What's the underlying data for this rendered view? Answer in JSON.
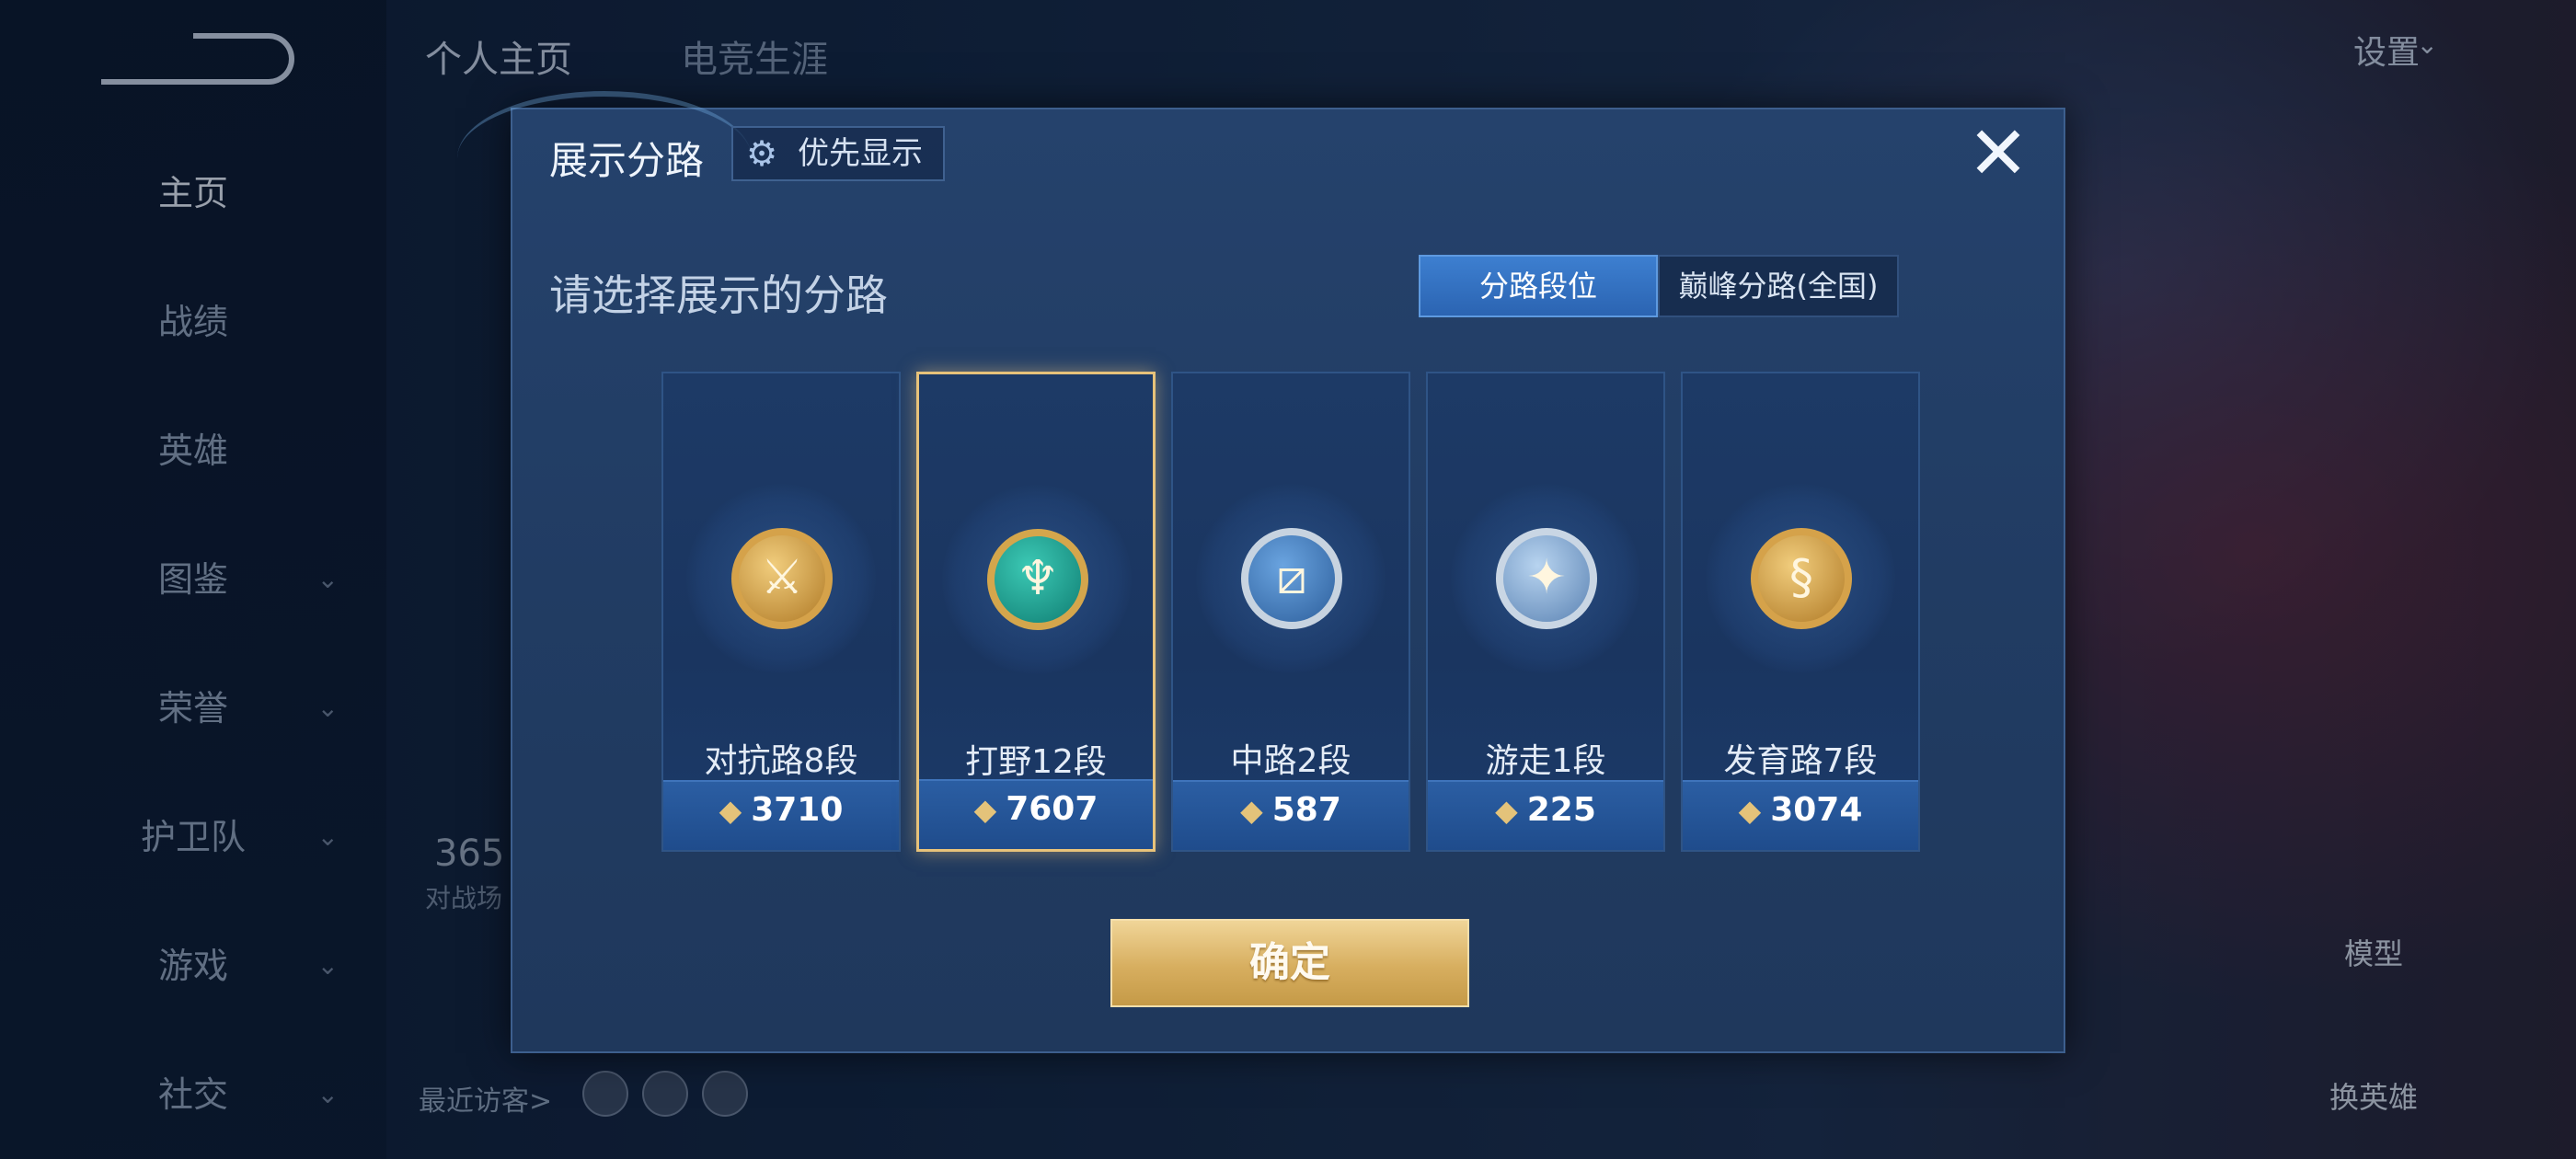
{
  "sidebar": {
    "items": [
      {
        "label": "主页",
        "active": true,
        "chevron": ""
      },
      {
        "label": "战绩",
        "chevron": ""
      },
      {
        "label": "英雄",
        "chevron": ""
      },
      {
        "label": "图鉴",
        "chevron": "⌄"
      },
      {
        "label": "荣誉",
        "chevron": "⌄"
      },
      {
        "label": "护卫队",
        "chevron": "⌄"
      },
      {
        "label": "游戏",
        "chevron": "⌄"
      },
      {
        "label": "社交",
        "chevron": "⌄"
      }
    ]
  },
  "top_nav": {
    "tab1": "个人主页",
    "tab2": "电竞生涯",
    "settings": "设置",
    "settings_chevron": "⌄"
  },
  "background": {
    "partial_number": "365",
    "partial_label": "对战场",
    "recent_visitors": "最近访客>",
    "model_label": "模型",
    "swap_hero_label": "换英雄"
  },
  "modal": {
    "title": "展示分路",
    "priority_label": "优先显示",
    "close_icon": "✕",
    "subtitle": "请选择展示的分路",
    "tabs": [
      "分路段位",
      "巅峰分路(全国)"
    ],
    "active_tab": "分路段位",
    "confirm_label": "确定",
    "lanes": [
      {
        "name": "对抗路8段",
        "score": "3710",
        "selected": false,
        "icon": "clash-lane-badge-icon"
      },
      {
        "name": "打野12段",
        "score": "7607",
        "selected": true,
        "icon": "jungle-badge-icon"
      },
      {
        "name": "中路2段",
        "score": "587",
        "selected": false,
        "icon": "mid-lane-badge-icon"
      },
      {
        "name": "游走1段",
        "score": "225",
        "selected": false,
        "icon": "roam-badge-icon"
      },
      {
        "name": "发育路7段",
        "score": "3074",
        "selected": false,
        "icon": "farm-lane-badge-icon"
      }
    ]
  },
  "colors": {
    "accent_gold": "#d7ae5f",
    "active_tab_blue": "#3d7fd0",
    "modal_bg": "#23406a"
  }
}
